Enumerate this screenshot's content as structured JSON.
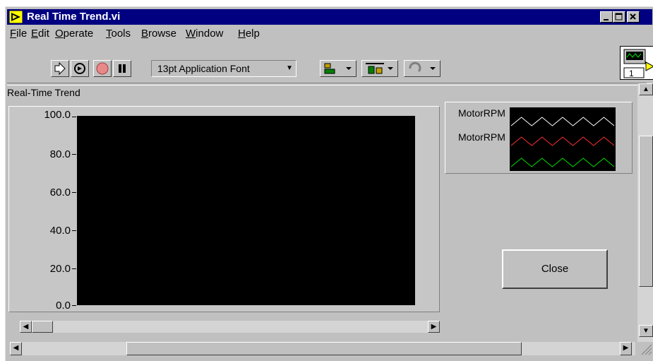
{
  "window": {
    "title": "Real Time Trend.vi"
  },
  "menu": {
    "items": [
      {
        "label": "File",
        "mnemonic": "F",
        "rest": "ile"
      },
      {
        "label": "Edit",
        "mnemonic": "E",
        "rest": "dit"
      },
      {
        "label": "Operate",
        "mnemonic": "O",
        "rest": "perate"
      },
      {
        "label": "Tools",
        "mnemonic": "T",
        "rest": "ools"
      },
      {
        "label": "Browse",
        "mnemonic": "B",
        "rest": "rowse"
      },
      {
        "label": "Window",
        "mnemonic": "W",
        "rest": "indow"
      },
      {
        "label": "Help",
        "mnemonic": "H",
        "rest": "elp"
      }
    ]
  },
  "toolbar": {
    "font_ring": "13pt Application Font",
    "icons": [
      "run-arrow-icon",
      "run-continuously-icon",
      "abort-stop-icon",
      "pause-icon",
      "align-objects-icon",
      "distribute-objects-icon",
      "reorder-icon"
    ]
  },
  "chart": {
    "label": "Real-Time Trend",
    "y_ticks": [
      "100.0",
      "80.0",
      "60.0",
      "40.0",
      "20.0",
      "0.0"
    ],
    "legend": [
      "MotorRPM",
      "MotorRPM"
    ],
    "plot_colors": [
      "#ffffff",
      "#ff3030",
      "#00e000"
    ]
  },
  "chart_data": {
    "type": "line",
    "title": "Real-Time Trend",
    "ylim": [
      0.0,
      100.0
    ],
    "y_ticks": [
      "100.0",
      "80.0",
      "60.0",
      "40.0",
      "20.0",
      "0.0"
    ],
    "series": [
      {
        "name": "MotorRPM",
        "values": []
      },
      {
        "name": "MotorRPM",
        "values": []
      },
      {
        "values": []
      }
    ],
    "grid": false,
    "legend_position": "top-right"
  },
  "buttons": {
    "close": "Close"
  },
  "connector": {
    "number": "1"
  },
  "colors": {
    "title_bar": "#000080",
    "panel": "#c0c0c0",
    "plot_bg": "#000000"
  }
}
